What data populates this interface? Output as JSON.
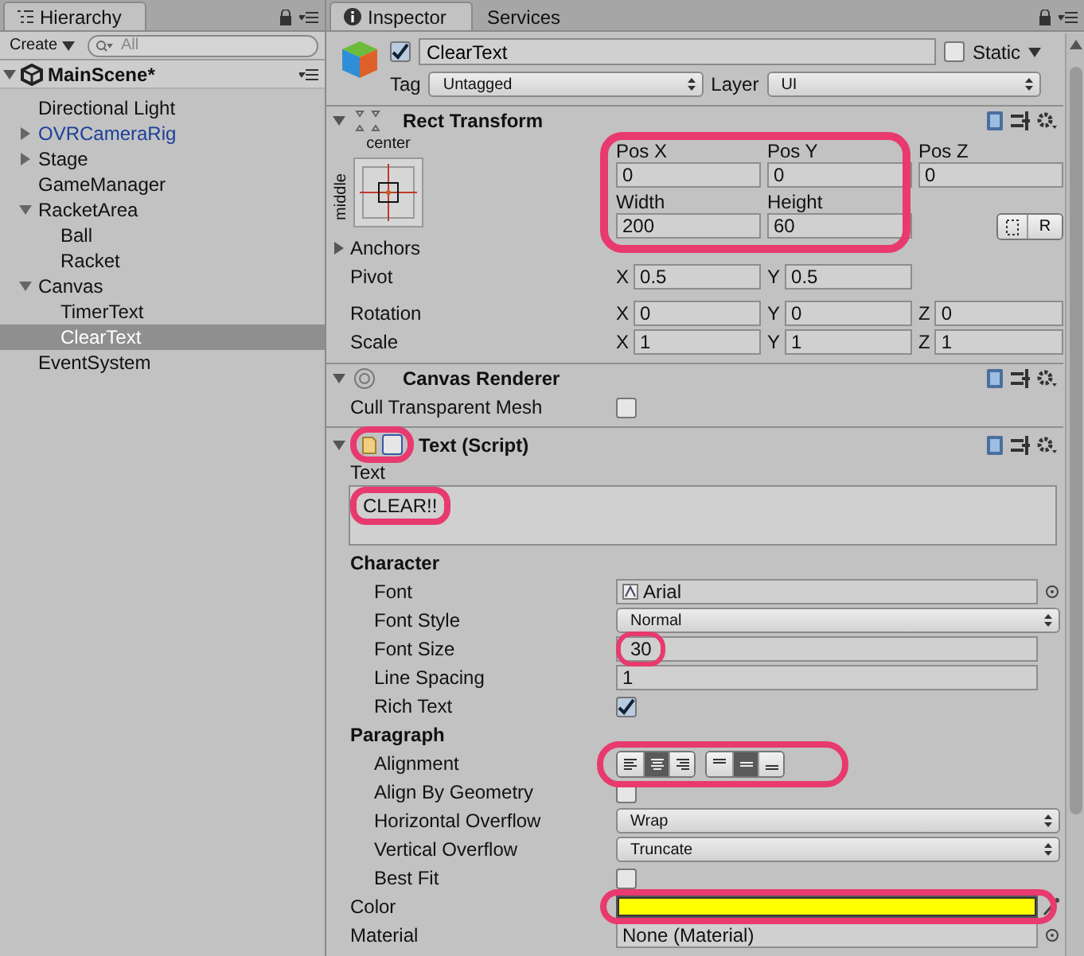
{
  "hierarchy": {
    "tab": "Hierarchy",
    "create": "Create",
    "search_placeholder": "All",
    "scene": {
      "name": "MainScene*",
      "expanded": true,
      "children": [
        {
          "name": "Directional Light",
          "prefab": false,
          "selected": false
        },
        {
          "name": "OVRCameraRig",
          "prefab": true,
          "expanded": false,
          "selected": false
        },
        {
          "name": "Stage",
          "prefab": false,
          "expanded": false,
          "selected": false
        },
        {
          "name": "GameManager",
          "prefab": false,
          "selected": false
        },
        {
          "name": "RacketArea",
          "prefab": false,
          "expanded": true,
          "selected": false,
          "children": [
            {
              "name": "Ball",
              "prefab": false,
              "selected": false
            },
            {
              "name": "Racket",
              "prefab": false,
              "selected": false
            }
          ]
        },
        {
          "name": "Canvas",
          "prefab": false,
          "expanded": true,
          "selected": false,
          "children": [
            {
              "name": "TimerText",
              "prefab": false,
              "selected": false
            },
            {
              "name": "ClearText",
              "prefab": false,
              "selected": true
            }
          ]
        },
        {
          "name": "EventSystem",
          "prefab": false,
          "selected": false
        }
      ]
    }
  },
  "inspector": {
    "tabs": [
      {
        "label": "Inspector",
        "selected": true
      },
      {
        "label": "Services",
        "selected": false
      }
    ],
    "object": {
      "active": true,
      "name": "ClearText",
      "static_label": "Static",
      "static": false,
      "tag_label": "Tag",
      "tag": "Untagged",
      "layer_label": "Layer",
      "layer": "UI"
    },
    "rect_transform": {
      "title": "Rect Transform",
      "anchor_h": "center",
      "anchor_v": "middle",
      "pos_fields": [
        {
          "label": "Pos X",
          "value": "0"
        },
        {
          "label": "Pos Y",
          "value": "0"
        },
        {
          "label": "Pos Z",
          "value": "0"
        }
      ],
      "size_fields": [
        {
          "label": "Width",
          "value": "200"
        },
        {
          "label": "Height",
          "value": "60"
        }
      ],
      "reset_button": "R",
      "anchors_label": "Anchors",
      "anchors_expanded": false,
      "rows": [
        {
          "label": "Pivot",
          "fields": [
            {
              "axis": "X",
              "value": "0.5"
            },
            {
              "axis": "Y",
              "value": "0.5"
            }
          ]
        },
        {
          "label": "Rotation",
          "fields": [
            {
              "axis": "X",
              "value": "0"
            },
            {
              "axis": "Y",
              "value": "0"
            },
            {
              "axis": "Z",
              "value": "0"
            }
          ]
        },
        {
          "label": "Scale",
          "fields": [
            {
              "axis": "X",
              "value": "1"
            },
            {
              "axis": "Y",
              "value": "1"
            },
            {
              "axis": "Z",
              "value": "1"
            }
          ]
        }
      ]
    },
    "canvas_renderer": {
      "title": "Canvas Renderer",
      "cull_label": "Cull Transparent Mesh",
      "cull_checked": false
    },
    "text_component": {
      "title": "Text (Script)",
      "enabled": false,
      "text_label": "Text",
      "text_value": "CLEAR!!",
      "sections": [
        {
          "title": "Character",
          "properties": [
            {
              "kind": "object",
              "label": "Font",
              "value": "Arial"
            },
            {
              "kind": "dropdown",
              "label": "Font Style",
              "value": "Normal"
            },
            {
              "kind": "number",
              "label": "Font Size",
              "value": "30"
            },
            {
              "kind": "number",
              "label": "Line Spacing",
              "value": "1"
            },
            {
              "kind": "checkbox",
              "label": "Rich Text",
              "checked": true
            }
          ]
        },
        {
          "title": "Paragraph",
          "properties": [
            {
              "kind": "alignment",
              "label": "Alignment",
              "horizontal": [
                {
                  "selected": false
                },
                {
                  "selected": true
                },
                {
                  "selected": false
                }
              ],
              "vertical": [
                {
                  "selected": false
                },
                {
                  "selected": true
                },
                {
                  "selected": false
                }
              ]
            },
            {
              "kind": "checkbox",
              "label": "Align By Geometry",
              "checked": false
            },
            {
              "kind": "dropdown",
              "label": "Horizontal Overflow",
              "value": "Wrap"
            },
            {
              "kind": "dropdown",
              "label": "Vertical Overflow",
              "value": "Truncate"
            },
            {
              "kind": "checkbox",
              "label": "Best Fit",
              "checked": false
            }
          ]
        }
      ],
      "properties": [
        {
          "kind": "color",
          "label": "Color",
          "color": "#ffff00"
        },
        {
          "kind": "object",
          "label": "Material",
          "value": "None (Material)"
        }
      ]
    }
  }
}
